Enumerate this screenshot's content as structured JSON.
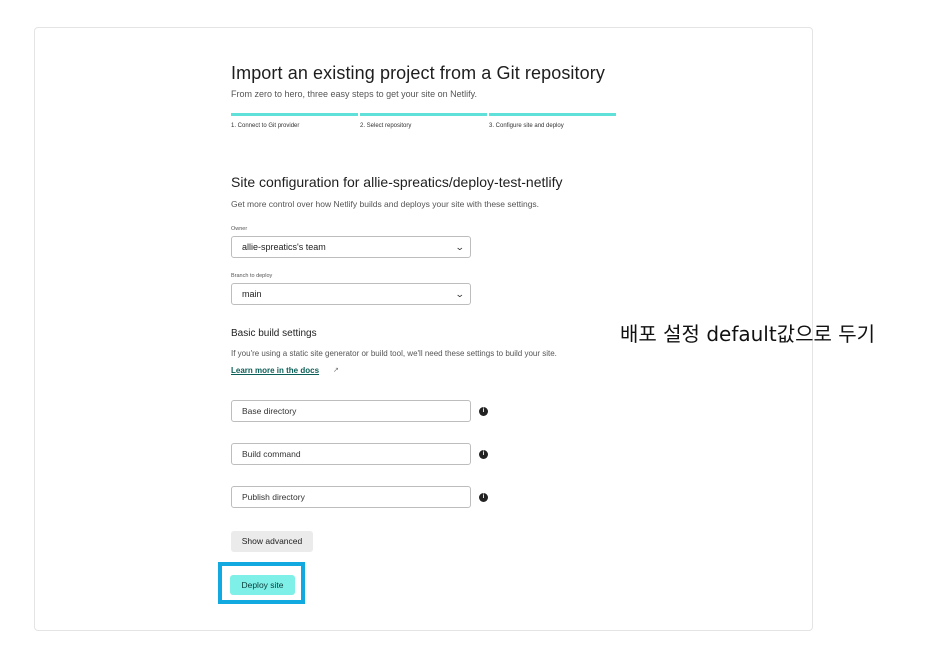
{
  "header": {
    "title": "Import an existing project from a Git repository",
    "subtitle": "From zero to hero, three easy steps to get your site on Netlify."
  },
  "steps": [
    {
      "label": "1. Connect to Git provider"
    },
    {
      "label": "2. Select repository"
    },
    {
      "label": "3. Configure site and deploy"
    }
  ],
  "config": {
    "title": "Site configuration for allie-spreatics/deploy-test-netlify",
    "subtitle": "Get more control over how Netlify builds and deploys your site with these settings.",
    "owner_label": "Owner",
    "owner_value": "allie-spreatics's team",
    "branch_label": "Branch to deploy",
    "branch_value": "main"
  },
  "build": {
    "title": "Basic build settings",
    "subtitle": "If you're using a static site generator or build tool, we'll need these settings to build your site.",
    "learn_link": "Learn more in the docs",
    "base_dir_placeholder": "Base directory",
    "build_cmd_placeholder": "Build command",
    "publish_dir_placeholder": "Publish directory",
    "show_advanced": "Show advanced",
    "deploy": "Deploy site"
  },
  "annotation": "배포 설정 default값으로 두기",
  "colors": {
    "accent": "#5fe0d9",
    "deploy_button": "#7ff0e8",
    "highlight_border": "#12a9e0",
    "link": "#0b5e57"
  }
}
